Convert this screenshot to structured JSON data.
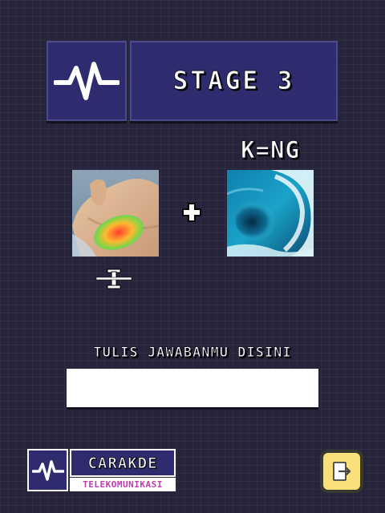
{
  "header": {
    "icon": "pulse-icon",
    "stage_title": "STAGE 3"
  },
  "clue": {
    "hint": "K=NG",
    "image_1": "hand-with-paint-photo",
    "operator_icon": "plus-icon",
    "image_1_letter": "I",
    "image_1_letter_icon": "struck-through-letter-i-icon",
    "image_2": "ocean-wave-photo"
  },
  "answer": {
    "label": "TULIS JAWABANMU DISINI",
    "value": "",
    "placeholder": ""
  },
  "logo": {
    "icon": "pulse-icon",
    "name": "CARAKDE",
    "subtitle": "TELEKOMUNIKASI"
  },
  "exit_button": {
    "icon": "exit-door-icon"
  },
  "colors": {
    "background": "#25243a",
    "panel": "#2e2c6e",
    "panel_border": "#4c4a8a",
    "exit_button": "#f9e07a",
    "logo_subtitle": "#c23bb0",
    "text": "#ffffff"
  }
}
